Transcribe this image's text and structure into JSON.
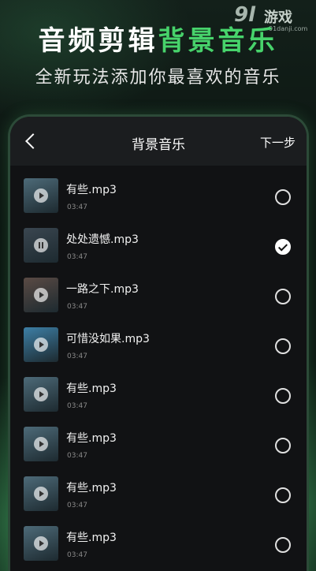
{
  "promo": {
    "headline_white": "音频剪辑",
    "headline_green": "背景音乐",
    "subline": "全新玩法添加你最喜欢的音乐"
  },
  "watermark": {
    "logo": "9l",
    "name": "游戏",
    "url": "91danji.com"
  },
  "nav": {
    "back_icon": "chevron-left-icon",
    "title": "背景音乐",
    "next_label": "下一步"
  },
  "songs": [
    {
      "name": "有些.mp3",
      "duration": "03:47",
      "selected": false,
      "thumb_color": "#4d6a78"
    },
    {
      "name": "处处遗憾.mp3",
      "duration": "03:47",
      "selected": true,
      "thumb_color": "#3a4650"
    },
    {
      "name": "一路之下.mp3",
      "duration": "03:47",
      "selected": false,
      "thumb_color": "#5a4a44"
    },
    {
      "name": "可惜没如果.mp3",
      "duration": "03:47",
      "selected": false,
      "thumb_color": "#3d7fa6"
    },
    {
      "name": "有些.mp3",
      "duration": "03:47",
      "selected": false,
      "thumb_color": "#4d6a78"
    },
    {
      "name": "有些.mp3",
      "duration": "03:47",
      "selected": false,
      "thumb_color": "#4d6a78"
    },
    {
      "name": "有些.mp3",
      "duration": "03:47",
      "selected": false,
      "thumb_color": "#4d6a78"
    },
    {
      "name": "有些.mp3",
      "duration": "03:47",
      "selected": false,
      "thumb_color": "#4d6a78"
    }
  ],
  "colors": {
    "accent_green": "#47d36b",
    "panel_bg": "#111214",
    "nav_bg": "#1b1d1f"
  }
}
